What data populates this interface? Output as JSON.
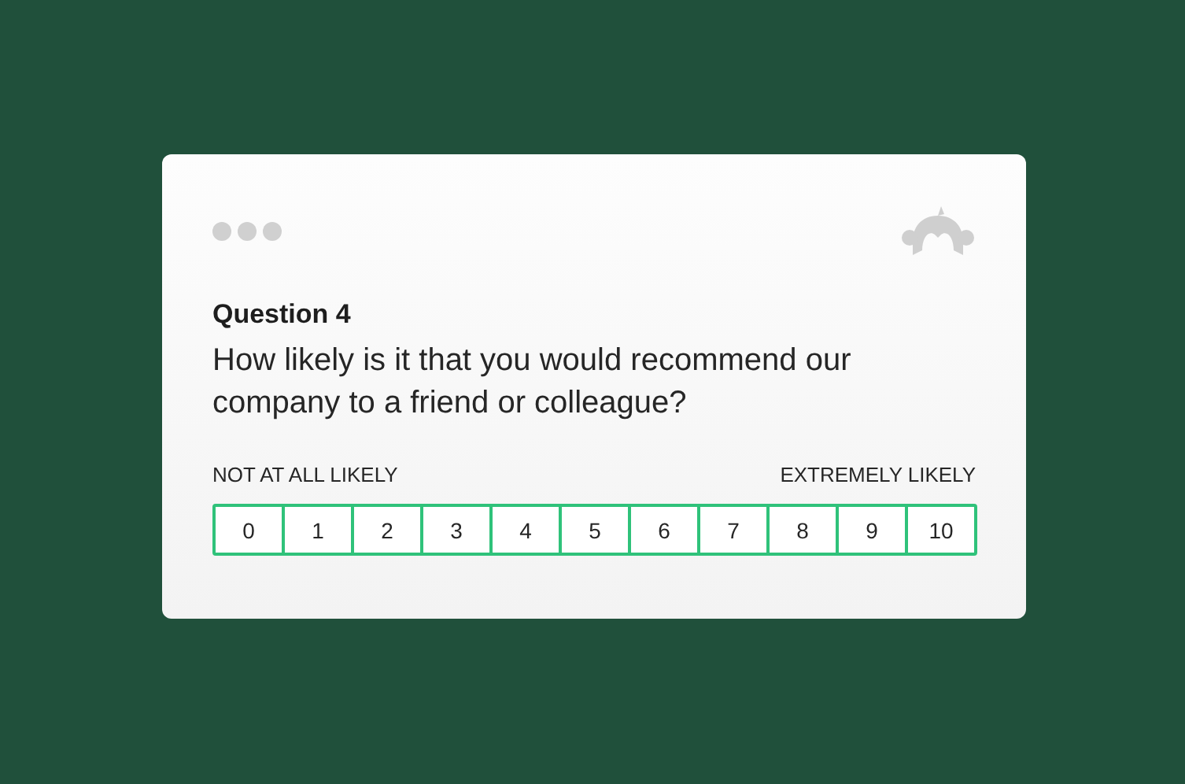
{
  "question": {
    "number": "Question 4",
    "text": "How likely is it that you would recommend our company to a friend or colleague?"
  },
  "scale": {
    "low_label": "NOT AT ALL LIKELY",
    "high_label": "EXTREMELY LIKELY",
    "options": [
      "0",
      "1",
      "2",
      "3",
      "4",
      "5",
      "6",
      "7",
      "8",
      "9",
      "10"
    ]
  }
}
